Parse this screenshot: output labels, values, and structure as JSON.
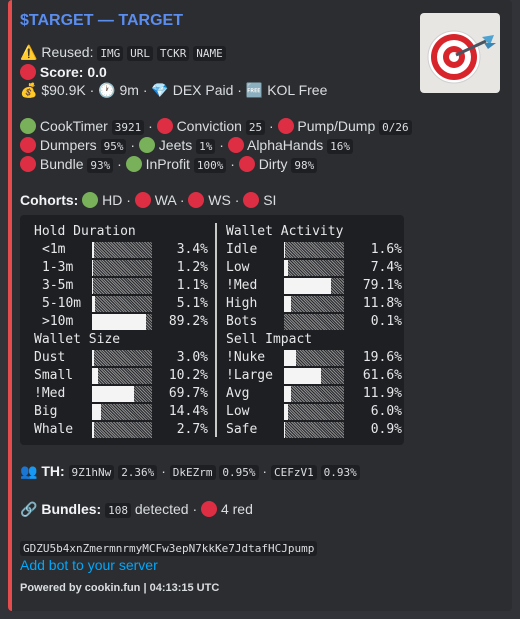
{
  "title": "$TARGET — TARGET",
  "reused": {
    "label": "Reused:",
    "tags": [
      "IMG",
      "URL",
      "TCKR",
      "NAME"
    ]
  },
  "score": {
    "label": "Score: 0.0"
  },
  "stats": {
    "mcap": "$90.9K",
    "age": "9m",
    "dex": "DEX Paid",
    "kol": "KOL Free"
  },
  "metrics": {
    "cooktimer": {
      "label": "CookTimer",
      "value": "3921"
    },
    "conviction": {
      "label": "Conviction",
      "value": "25"
    },
    "pumpdump": {
      "label": "Pump/Dump",
      "value": "0/26"
    },
    "dumpers": {
      "label": "Dumpers",
      "value": "95%"
    },
    "jeets": {
      "label": "Jeets",
      "value": "1%"
    },
    "alphahands": {
      "label": "AlphaHands",
      "value": "16%"
    },
    "bundle": {
      "label": "Bundle",
      "value": "93%"
    },
    "inprofit": {
      "label": "InProfit",
      "value": "100%"
    },
    "dirty": {
      "label": "Dirty",
      "value": "98%"
    }
  },
  "cohorts": {
    "label": "Cohorts:",
    "items": [
      "HD",
      "WA",
      "WS",
      "SI"
    ]
  },
  "panels": {
    "hold": {
      "title": "Hold Duration",
      "rows": [
        {
          "label": "<1m",
          "pct": "3.4%",
          "fill": 0.034
        },
        {
          "label": "1-3m",
          "pct": "1.2%",
          "fill": 0.012
        },
        {
          "label": "3-5m",
          "pct": "1.1%",
          "fill": 0.011
        },
        {
          "label": "5-10m",
          "pct": "5.1%",
          "fill": 0.051
        },
        {
          "label": ">10m",
          "pct": "89.2%",
          "fill": 0.892
        }
      ]
    },
    "activity": {
      "title": "Wallet Activity",
      "rows": [
        {
          "label": "Idle",
          "pct": "1.6%",
          "fill": 0.016
        },
        {
          "label": "Low",
          "pct": "7.4%",
          "fill": 0.074
        },
        {
          "label": "!Med",
          "pct": "79.1%",
          "fill": 0.791
        },
        {
          "label": "High",
          "pct": "11.8%",
          "fill": 0.118
        },
        {
          "label": "Bots",
          "pct": "0.1%",
          "fill": 0.001
        }
      ]
    },
    "size": {
      "title": "Wallet Size",
      "rows": [
        {
          "label": "Dust",
          "pct": "3.0%",
          "fill": 0.03
        },
        {
          "label": "Small",
          "pct": "10.2%",
          "fill": 0.102
        },
        {
          "label": "!Med",
          "pct": "69.7%",
          "fill": 0.697
        },
        {
          "label": "Big",
          "pct": "14.4%",
          "fill": 0.144
        },
        {
          "label": "Whale",
          "pct": "2.7%",
          "fill": 0.027
        }
      ]
    },
    "impact": {
      "title": "Sell Impact",
      "rows": [
        {
          "label": "!Nuke",
          "pct": "19.6%",
          "fill": 0.196
        },
        {
          "label": "!Large",
          "pct": "61.6%",
          "fill": 0.616
        },
        {
          "label": "Avg",
          "pct": "11.9%",
          "fill": 0.119
        },
        {
          "label": "Low",
          "pct": "6.0%",
          "fill": 0.06
        },
        {
          "label": "Safe",
          "pct": "0.9%",
          "fill": 0.009
        }
      ]
    }
  },
  "holders": {
    "label": "TH:",
    "items": [
      {
        "addr": "9Z1hNw",
        "pct": "2.36%"
      },
      {
        "addr": "DkEZrm",
        "pct": "0.95%"
      },
      {
        "addr": "CEFzV1",
        "pct": "0.93%"
      }
    ]
  },
  "bundles": {
    "label": "Bundles:",
    "count": "108",
    "detected": "detected",
    "red_count": "4",
    "red_label": "red"
  },
  "contract": "GDZU5b4xnZmermnrmyMCFw3epN7kkKe7JdtafHCJpump",
  "add_bot": "Add bot to your server",
  "footer": "Powered by cookin.fun | 04:13:15 UTC",
  "colors": {
    "accent_bar": "#e34d4d",
    "title": "#5b8def",
    "link": "#00a8fc",
    "red_dot": "#dd2e44",
    "green_dot": "#78b159"
  }
}
